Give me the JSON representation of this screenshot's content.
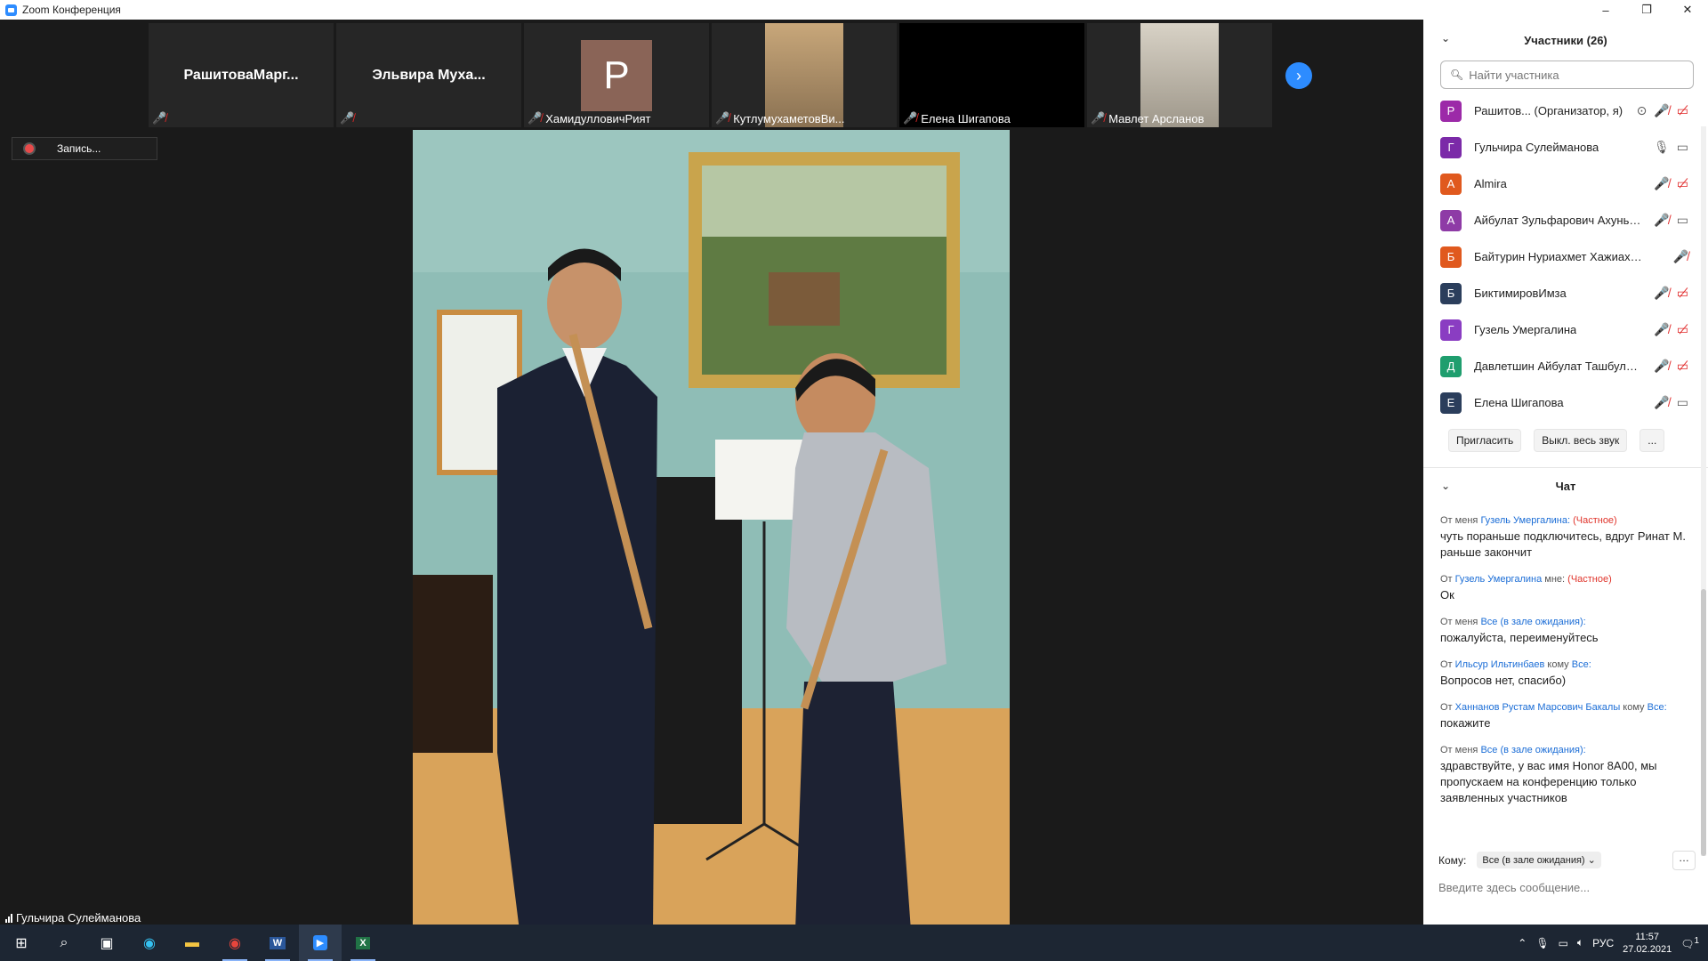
{
  "window": {
    "title": "Zoom Конференция",
    "min": "–",
    "max": "❐",
    "close": "✕"
  },
  "tiles": [
    {
      "name": "РашитоваМарг...",
      "label": ""
    },
    {
      "name": "Эльвира  Муха...",
      "label": ""
    },
    {
      "avatar": "P",
      "label": "ХамидулловичРият"
    },
    {
      "label": "КутлумухаметовВи..."
    },
    {
      "label": "Елена Шигапова"
    },
    {
      "label": "Мавлет Арсланов"
    }
  ],
  "recording": {
    "label": "Запись..."
  },
  "speaker": {
    "name": "Гульчира Сулейманова"
  },
  "participants": {
    "title": "Участники (26)",
    "search_placeholder": "Найти участника",
    "items": [
      {
        "initial": "Р",
        "name": "Рашитов...   (Организатор, я)",
        "color": "#9c2aa8"
      },
      {
        "initial": "Г",
        "name": "Гульчира Сулейманова",
        "color": "#7b2aa8"
      },
      {
        "initial": "A",
        "name": "Almira",
        "color": "#e0591e"
      },
      {
        "initial": "А",
        "name": "Айбулат Зульфарович Ахуньян...",
        "color": "#8e3ba6"
      },
      {
        "initial": "Б",
        "name": "Байтурин Нуриахмет Хажиахметов...",
        "color": "#e0591e"
      },
      {
        "initial": "Б",
        "name": "БиктимировИмза",
        "color": "#2b3e5c"
      },
      {
        "initial": "Г",
        "name": "Гузель Умергалина",
        "color": "#8a3dc2"
      },
      {
        "initial": "Д",
        "name": "Давлетшин Айбулат Ташбулат...",
        "color": "#1f9e6e"
      },
      {
        "initial": "Е",
        "name": "Елена Шигапова",
        "color": "#2b3e5c"
      }
    ],
    "invite": "Пригласить",
    "mute_all": "Выкл. весь звук",
    "more": "..."
  },
  "chat": {
    "title": "Чат",
    "messages": [
      {
        "from": "От меня",
        "who": "Гузель Умергалина:",
        "priv": "(Частное)",
        "text": "чуть пораньше подключитесь, вдруг Ринат М. раньше закончит"
      },
      {
        "from": "От",
        "who": "Гузель Умергалина",
        "to": "мне:",
        "priv": "(Частное)",
        "text": "Ок"
      },
      {
        "from": "От меня",
        "who": "Все (в зале ожидания):",
        "text": "пожалуйста, переименуйтесь"
      },
      {
        "from": "От",
        "who": "Ильсур Ильтинбаев",
        "to": "кому",
        "who2": "Все:",
        "text": "Вопросов нет, спасибо)"
      },
      {
        "from": "От",
        "who": "Ханнанов Рустам Марсович Бакалы",
        "to": "кому",
        "who2": "Все:",
        "text": "покажите"
      },
      {
        "from": "От меня",
        "who": "Все (в зале ожидания):",
        "text": "здравствуйте, у вас имя Honor 8A00, мы пропускаем на конференцию только заявленных участников"
      }
    ],
    "to_label": "Кому:",
    "to_value": "Все (в зале ожидания)",
    "input_placeholder": "Введите здесь сообщение..."
  },
  "taskbar": {
    "lang": "РУС",
    "time": "11:57",
    "date": "27.02.2021",
    "notif": "1"
  }
}
